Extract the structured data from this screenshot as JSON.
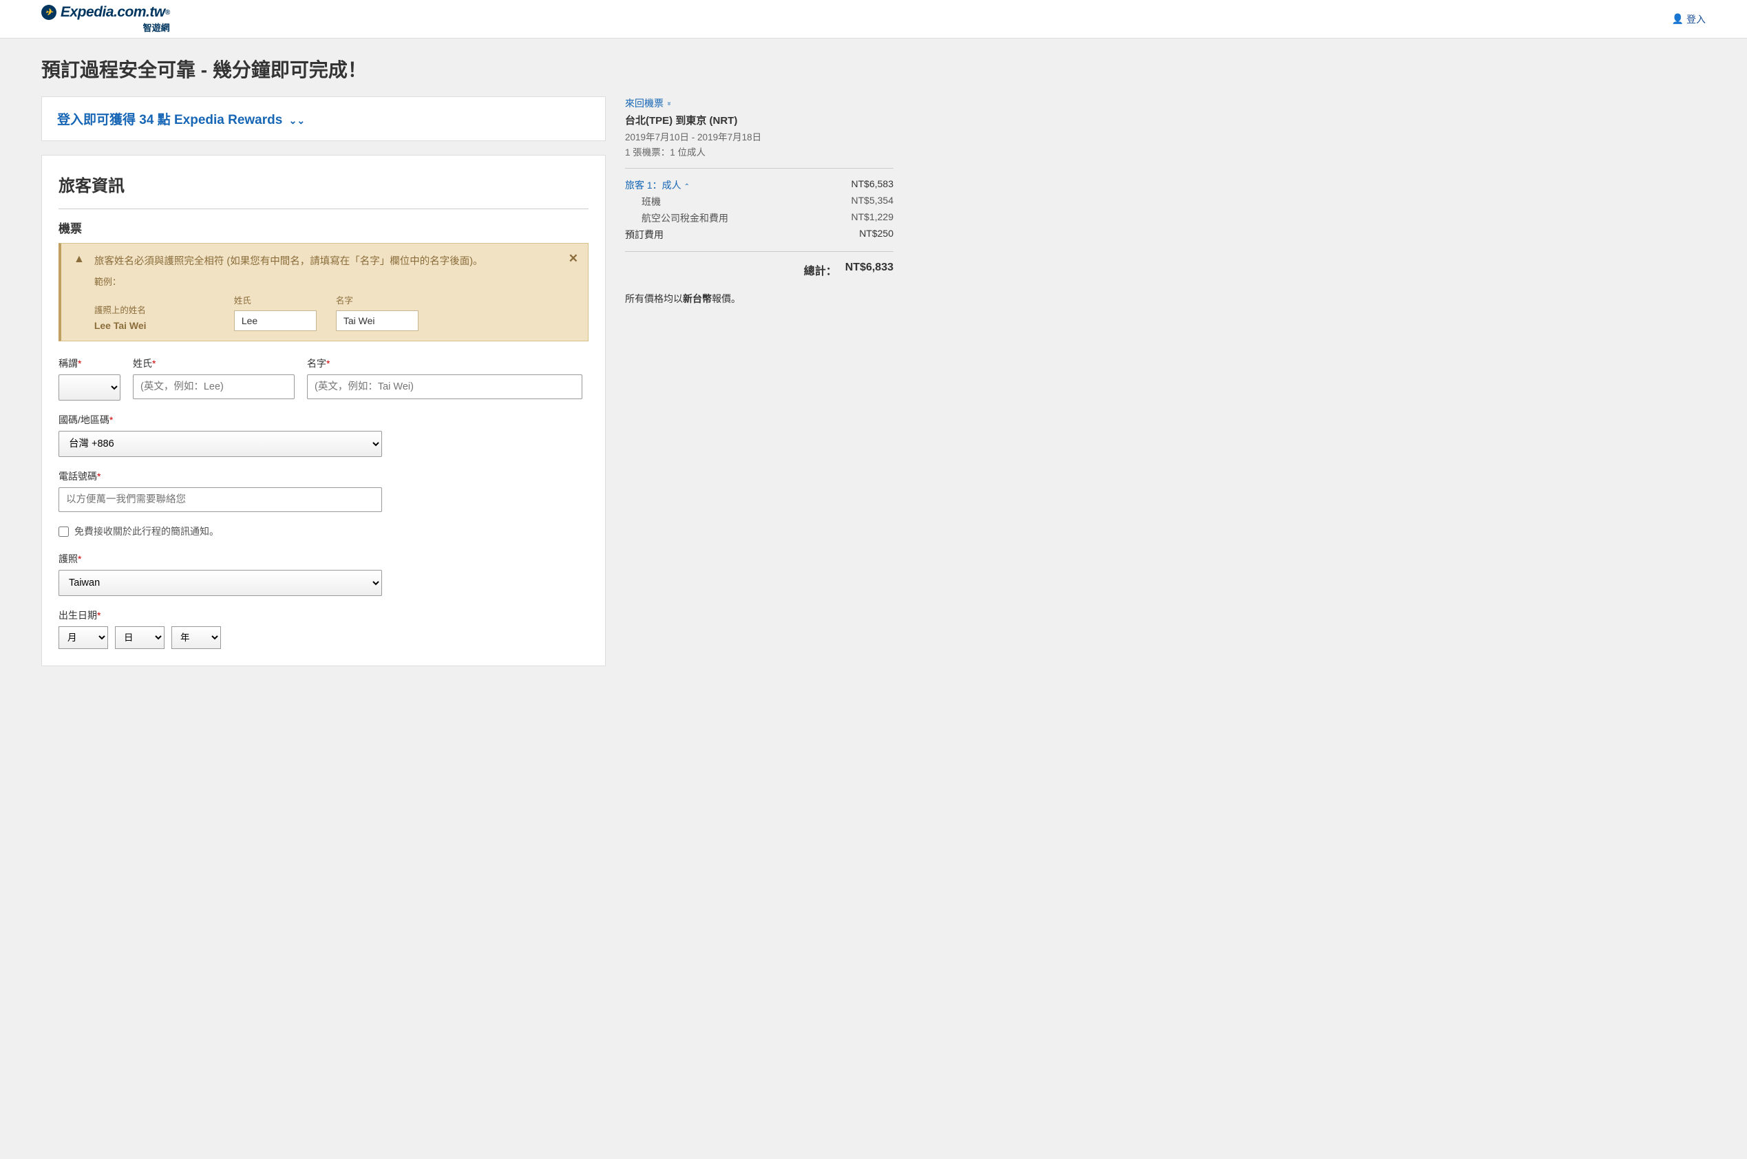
{
  "header": {
    "logo_main": "Expedia.com.tw",
    "logo_sub": "智遊網",
    "login_label": "登入"
  },
  "page_title": "預訂過程安全可靠 - 幾分鐘即可完成！",
  "rewards": {
    "text": "登入即可獲得 34 點 Expedia Rewards"
  },
  "traveler_section": {
    "title": "旅客資訊",
    "subtitle": "機票",
    "alert": {
      "message": "旅客姓名必須與護照完全相符 (如果您有中間名，請填寫在「名字」欄位中的名字後面)。",
      "example_label": "範例：",
      "passport_name_label": "護照上的姓名",
      "passport_name_value": "Lee Tai Wei",
      "surname_label": "姓氏",
      "surname_value": "Lee",
      "firstname_label": "名字",
      "firstname_value": "Tai Wei"
    },
    "fields": {
      "title_label": "稱謂",
      "surname_label": "姓氏",
      "surname_placeholder": "(英文，例如：Lee)",
      "firstname_label": "名字",
      "firstname_placeholder": "(英文，例如：Tai Wei)",
      "country_code_label": "國碼/地區碼",
      "country_code_value": "台灣 +886",
      "phone_label": "電話號碼",
      "phone_placeholder": "以方便萬一我們需要聯絡您",
      "sms_checkbox": "免費接收關於此行程的簡訊通知。",
      "passport_label": "護照",
      "passport_value": "Taiwan",
      "dob_label": "出生日期",
      "dob_month": "月",
      "dob_day": "日",
      "dob_year": "年"
    }
  },
  "summary": {
    "roundtrip_label": "來回機票",
    "route": "台北(TPE) 到東京 (NRT)",
    "dates": "2019年7月10日 - 2019年7月18日",
    "tickets": "1 張機票：1 位成人",
    "traveler_label": "旅客 1：成人",
    "traveler_price": "NT$6,583",
    "flight_label": "班機",
    "flight_price": "NT$5,354",
    "taxes_label": "航空公司稅金和費用",
    "taxes_price": "NT$1,229",
    "booking_fee_label": "預訂費用",
    "booking_fee_price": "NT$250",
    "total_label": "總計：",
    "total_price": "NT$6,833",
    "currency_note_prefix": "所有價格均以",
    "currency_note_bold": "新台幣",
    "currency_note_suffix": "報價。"
  }
}
